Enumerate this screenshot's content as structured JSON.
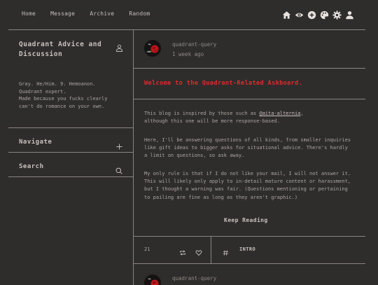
{
  "nav": {
    "links": [
      "Home",
      "Message",
      "Archive",
      "Random"
    ],
    "icons": [
      "home-icon",
      "eye-icon",
      "add-icon",
      "palette-icon",
      "gear-icon",
      "person-icon"
    ]
  },
  "sidebar": {
    "title": "Quadrant Advice and Discussion",
    "bio_line1": "Gray. He/Him. 9. Hemoanon.",
    "bio_line2": "Quadrant expert.",
    "bio_line3": "Made because you fucks clearly",
    "bio_line4": "can't do romance on your own.",
    "navigate_label": "Navigate",
    "search_label": "Search"
  },
  "post": {
    "author": "quadrant-query",
    "time": "1 week ago",
    "title": "Welcome to the Quadrant-Related Askboard.",
    "p1_before": "This blog is inspired by those such as ",
    "p1_link": "@aita-alternia",
    "p1_after": ",",
    "p1_line2": "although this one will be more response-based.",
    "p2": "Here, I'll be answering questions of all kinds, from smaller inquiries like gift ideas to bigger asks for situational advice. There's hardly a limit on questions, so ask away.",
    "p3": "My only rule is that if I do not like your mail, I will not answer it. This will likely only apply to in-detail mature content or harassment, but I thought a warning was fair. (Questions mentioning or pertaining to pailing are fine as long as they aren't graphic.)",
    "keep_reading": "Keep Reading",
    "notes": "21",
    "tag": "INTRO"
  },
  "next_post": {
    "author": "quadrant-query"
  },
  "colors": {
    "background": "#2f2c2c",
    "accent_red": "#e02b2b",
    "line": "#8a8582"
  }
}
